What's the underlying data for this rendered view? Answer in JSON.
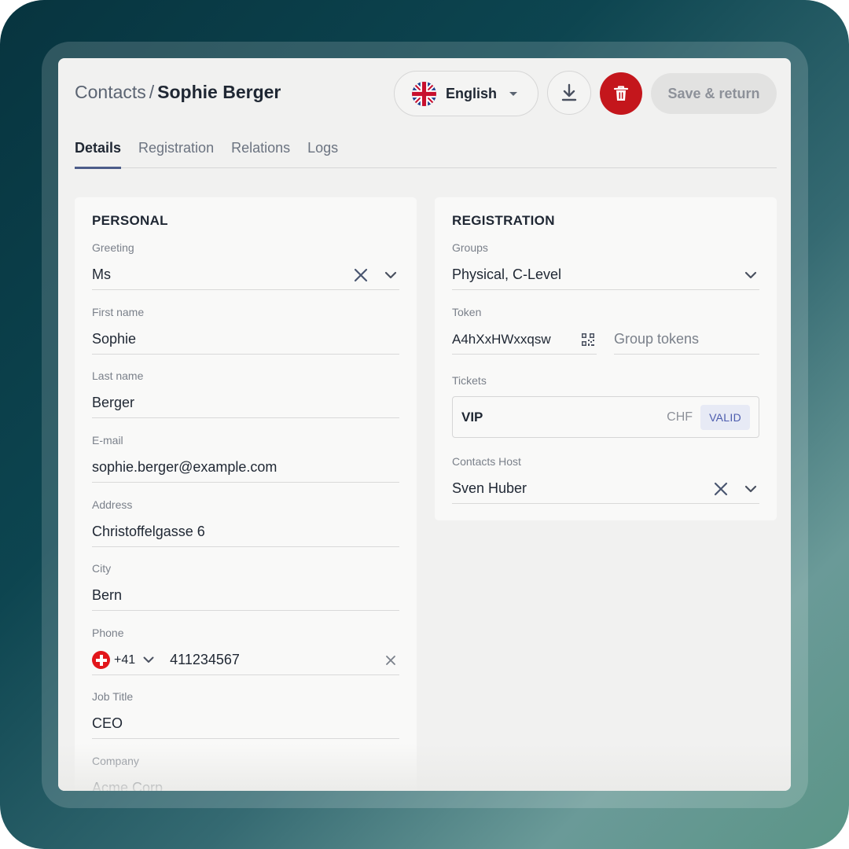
{
  "header": {
    "breadcrumb_root": "Contacts",
    "breadcrumb_separator": "/",
    "breadcrumb_current": "Sophie Berger",
    "language": {
      "selected": "English",
      "flag_icon": "flag-uk-icon"
    },
    "download_icon": "download-icon",
    "delete_icon": "trash-icon",
    "save_label": "Save & return"
  },
  "tabs": [
    {
      "label": "Details",
      "active": true
    },
    {
      "label": "Registration",
      "active": false
    },
    {
      "label": "Relations",
      "active": false
    },
    {
      "label": "Logs",
      "active": false
    }
  ],
  "personal": {
    "title": "PERSONAL",
    "greeting": {
      "label": "Greeting",
      "value": "Ms"
    },
    "first_name": {
      "label": "First name",
      "value": "Sophie"
    },
    "last_name": {
      "label": "Last name",
      "value": "Berger"
    },
    "email": {
      "label": "E-mail",
      "value": "sophie.berger@example.com"
    },
    "address": {
      "label": "Address",
      "value": "Christoffelgasse 6"
    },
    "city": {
      "label": "City",
      "value": "Bern"
    },
    "phone": {
      "label": "Phone",
      "country_code": "+41",
      "number": "411234567",
      "flag_icon": "flag-ch-icon"
    },
    "job_title": {
      "label": "Job Title",
      "value": "CEO"
    },
    "company": {
      "label": "Company",
      "value": "Acme Corp"
    }
  },
  "registration": {
    "title": "REGISTRATION",
    "groups": {
      "label": "Groups",
      "value": "Physical, C-Level"
    },
    "token": {
      "label": "Token",
      "value": "A4hXxHWxxqsw",
      "group_tokens_placeholder": "Group tokens"
    },
    "tickets": {
      "label": "Tickets",
      "items": [
        {
          "name": "VIP",
          "currency": "CHF",
          "status": "VALID"
        }
      ]
    },
    "host": {
      "label": "Contacts Host",
      "value": "Sven Huber"
    }
  },
  "colors": {
    "accent": "#4c5c8a",
    "danger": "#c4161c",
    "status_valid_bg": "#e7eaf5",
    "status_valid_text": "#4c5cae"
  }
}
